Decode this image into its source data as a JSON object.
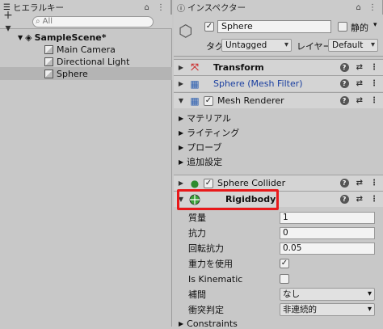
{
  "hierarchy": {
    "tab_label": "ヒエラルキー",
    "tab_icons": "⌂ ⋮",
    "add_label": "+ ▾",
    "search_placeholder": "All",
    "scene_name": "SampleScene*",
    "items": [
      {
        "label": "Main Camera"
      },
      {
        "label": "Directional Light"
      },
      {
        "label": "Sphere"
      }
    ]
  },
  "inspector": {
    "tab_label": "インスペクター",
    "tab_icons": "⌂ ⋮",
    "object_name": "Sphere",
    "static_label": "静的",
    "tag_label": "タグ",
    "tag_value": "Untagged",
    "layer_label": "レイヤー",
    "layer_value": "Default",
    "components": {
      "transform": "Transform",
      "mesh_filter": "Sphere (Mesh Filter)",
      "mesh_renderer": "Mesh Renderer",
      "renderer_sections": [
        "マテリアル",
        "ライティング",
        "プローブ",
        "追加設定"
      ],
      "sphere_collider": "Sphere Collider",
      "rigidbody": "Rigidbody",
      "constraints": "Constraints"
    },
    "rigidbody_props": {
      "mass_label": "質量",
      "mass_value": "1",
      "drag_label": "抗力",
      "drag_value": "0",
      "angular_label": "回転抗力",
      "angular_value": "0.05",
      "gravity_label": "重力を使用",
      "kinematic_label": "Is Kinematic",
      "interp_label": "補間",
      "interp_value": "なし",
      "collision_label": "衝突判定",
      "collision_value": "非連続的"
    },
    "checks": {
      "use_gravity": true,
      "is_kinematic": false
    },
    "mesh_filter_color": "#1a3fa0",
    "highlight_color": "#e8191b"
  }
}
